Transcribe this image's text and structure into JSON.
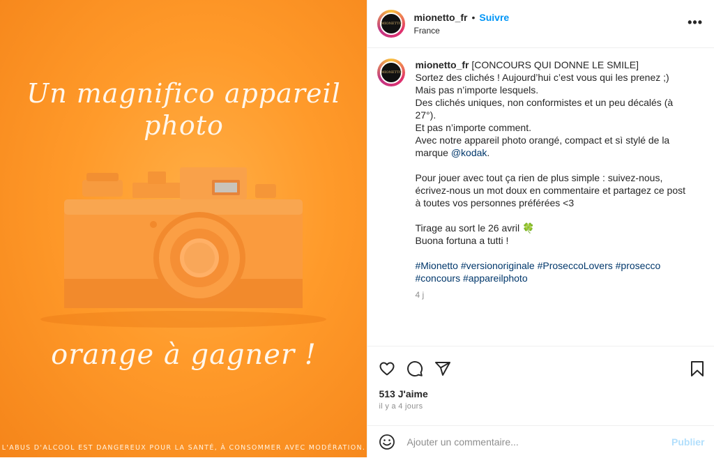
{
  "media": {
    "headline_top": "Un magnifico appareil photo",
    "headline_bottom": "orange à gagner !",
    "warning": "L'ABUS D'ALCOOL EST DANGEREUX POUR LA SANTÉ, À CONSOMMER AVEC MODÉRATION."
  },
  "header": {
    "username": "mionetto_fr",
    "separator": "•",
    "follow_label": "Suivre",
    "location": "France",
    "more_label": "•••",
    "avatar_text": "MIONETTO"
  },
  "caption": {
    "username": "mionetto_fr",
    "lines": [
      "[CONCOURS QUI DONNE LE SMILE]",
      "Sortez des clichés ! Aujourd’hui c’est vous qui les prenez ;)",
      "Mais pas n’importe lesquels.",
      "Des clichés uniques, non conformistes et un peu décalés (à 27°).",
      "Et pas n’importe comment.",
      "Avec notre appareil photo orangé, compact et sì stylé de la marque "
    ],
    "mention": "@kodak",
    "mention_suffix": ".",
    "para2": "Pour jouer avec tout ça rien de plus simple : suivez-nous, écrivez-nous un mot doux en commentaire et partagez ce post à toutes vos personnes préférées <3",
    "draw": "Tirage au sort le 26 avril 🍀",
    "wish": "Buona fortuna a tutti !",
    "hashtags": "#Mionetto #versionoriginale #ProseccoLovers #prosecco #concours #appareilphoto",
    "age": "4 j"
  },
  "stats": {
    "likes": "513 J'aime",
    "time_ago": "il y a 4 jours"
  },
  "comment": {
    "placeholder": "Ajouter un commentaire...",
    "publish_label": "Publier"
  }
}
